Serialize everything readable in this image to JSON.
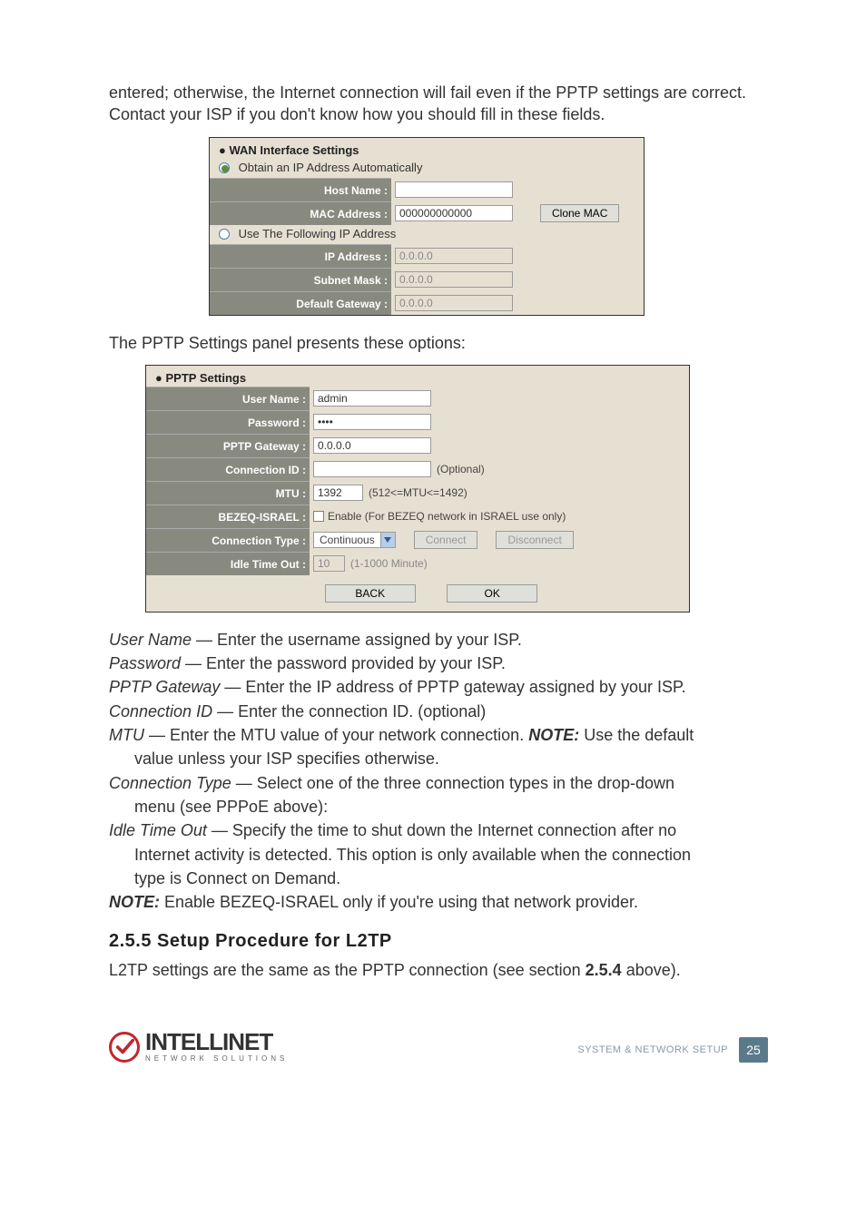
{
  "intro_text": "entered; otherwise, the Internet connection will fail even if the PPTP settings are correct. Contact your ISP if you don't know how you should fill in these fields.",
  "wan": {
    "title": "WAN Interface Settings",
    "obtain_auto": "Obtain an IP Address Automatically",
    "use_following": "Use The Following IP Address",
    "host_name_label": "Host Name :",
    "host_name_value": "",
    "mac_label": "MAC Address :",
    "mac_value": "000000000000",
    "clone_btn": "Clone MAC",
    "ip_label": "IP Address :",
    "ip_value": "0.0.0.0",
    "mask_label": "Subnet Mask :",
    "mask_value": "0.0.0.0",
    "gw_label": "Default Gateway :",
    "gw_value": "0.0.0.0"
  },
  "pptp_intro": "The PPTP Settings panel presents these options:",
  "pptp": {
    "title": "PPTP Settings",
    "user_label": "User Name :",
    "user_value": "admin",
    "pass_label": "Password :",
    "pass_value": "••••",
    "gateway_label": "PPTP Gateway :",
    "gateway_value": "0.0.0.0",
    "connid_label": "Connection ID :",
    "connid_value": "",
    "connid_hint": "(Optional)",
    "mtu_label": "MTU :",
    "mtu_value": "1392",
    "mtu_hint": "(512<=MTU<=1492)",
    "bezeq_label": "BEZEQ-ISRAEL :",
    "bezeq_text": "Enable (For BEZEQ network in ISRAEL use only)",
    "conntype_label": "Connection Type :",
    "conntype_value": "Continuous",
    "connect_btn": "Connect",
    "disconnect_btn": "Disconnect",
    "idle_label": "Idle Time Out :",
    "idle_value": "10",
    "idle_hint": "(1-1000 Minute)",
    "back_btn": "BACK",
    "ok_btn": "OK"
  },
  "defs": {
    "user_name": "User Name — Enter the username assigned by your ISP.",
    "password": "Password — Enter the password provided by your ISP.",
    "pptp_gw": "PPTP Gateway — Enter the IP address of PPTP gateway assigned by your ISP.",
    "conn_id": "Connection ID — Enter the connection ID. (optional)",
    "mtu_1": "MTU — Enter the MTU value of your network connection. ",
    "mtu_note": "NOTE:",
    "mtu_2": " Use the default",
    "mtu_3": "value unless your ISP specifies otherwise.",
    "conntype_1": "Connection Type — Select one of the three connection types in the drop-down",
    "conntype_2": "menu (see PPPoE above):",
    "idle_1": "Idle Time Out — Specify the time to shut down the Internet connection after no",
    "idle_2": "Internet activity is detected. This option is only available when the connection",
    "idle_3": "type is Connect on Demand.",
    "note_label": "NOTE:",
    "note_text": " Enable BEZEQ-ISRAEL only if you're using that network provider."
  },
  "section_head": "2.5.5  Setup Procedure for L2TP",
  "l2tp_text_1": "L2TP settings are the same as the PPTP connection (see section ",
  "l2tp_bold": "2.5.4",
  "l2tp_text_2": " above).",
  "footer": {
    "brand": "INTELLINET",
    "sub": "NETWORK SOLUTIONS",
    "section": "SYSTEM & NETWORK SETUP",
    "page": "25"
  }
}
